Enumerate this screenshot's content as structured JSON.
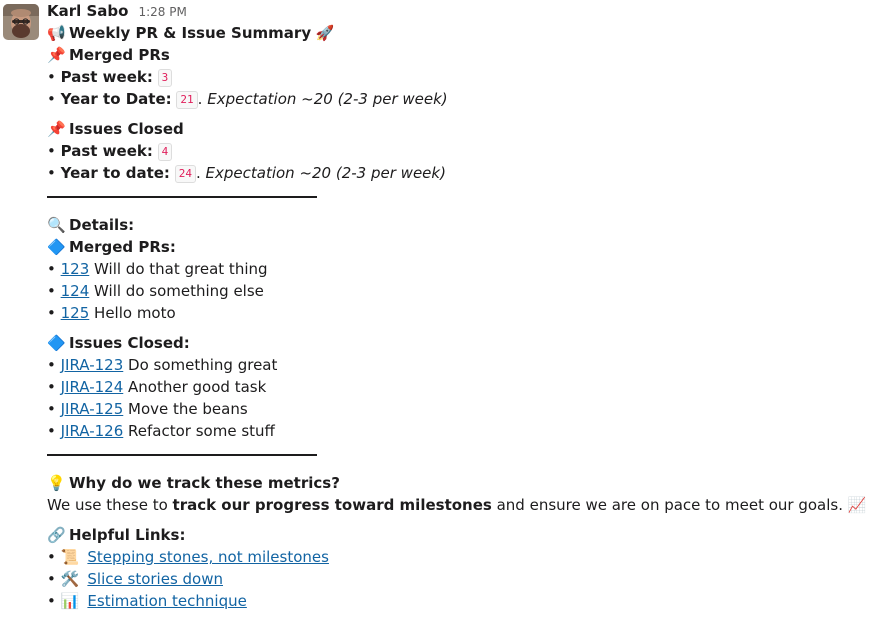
{
  "message": {
    "author": "Karl Sabo",
    "time": "1:28 PM",
    "title_emoji": "📢",
    "title": "Weekly PR & Issue Summary",
    "title_trailing_emoji": "🚀",
    "merged_prs": {
      "emoji": "📌",
      "heading": "Merged PRs",
      "past_week_label": "Past week:",
      "past_week_value": "3",
      "ytd_label": "Year to Date:",
      "ytd_value": "21",
      "ytd_sep": ". ",
      "ytd_expectation": "Expectation ~20 (2-3 per week)"
    },
    "issues_closed": {
      "emoji": "📌",
      "heading": "Issues Closed",
      "past_week_label": "Past week:",
      "past_week_value": "4",
      "ytd_label": "Year to date:",
      "ytd_value": "24",
      "ytd_sep": ". ",
      "ytd_expectation": "Expectation ~20 (2-3 per week)"
    },
    "details": {
      "emoji": "🔍",
      "heading": "Details:",
      "merged_heading_emoji": "🔷",
      "merged_heading": "Merged PRs:",
      "prs": [
        {
          "id": "123",
          "text": " Will do that great thing"
        },
        {
          "id": "124",
          "text": " Will do something else"
        },
        {
          "id": "125",
          "text": " Hello moto"
        }
      ],
      "issues_heading_emoji": "🔷",
      "issues_heading": "Issues Closed:",
      "issues": [
        {
          "id": "JIRA-123",
          "text": " Do something great"
        },
        {
          "id": "JIRA-124",
          "text": " Another good task"
        },
        {
          "id": "JIRA-125",
          "text": " Move the beans"
        },
        {
          "id": "JIRA-126",
          "text": " Refactor some stuff"
        }
      ]
    },
    "why": {
      "emoji": "💡",
      "heading": "Why do we track these metrics?",
      "text_before": "We use these to ",
      "text_bold": "track our progress toward milestones",
      "text_after": " and ensure we are on pace to meet our goals. ",
      "trailing_emoji": "📈"
    },
    "links": {
      "emoji": "🔗",
      "heading": "Helpful Links:",
      "items": [
        {
          "emoji": "📜",
          "label": "Stepping stones, not milestones"
        },
        {
          "emoji": "🛠️",
          "label": "Slice stories down"
        },
        {
          "emoji": "📊",
          "label": "Estimation technique"
        }
      ]
    },
    "bullet": "• "
  }
}
